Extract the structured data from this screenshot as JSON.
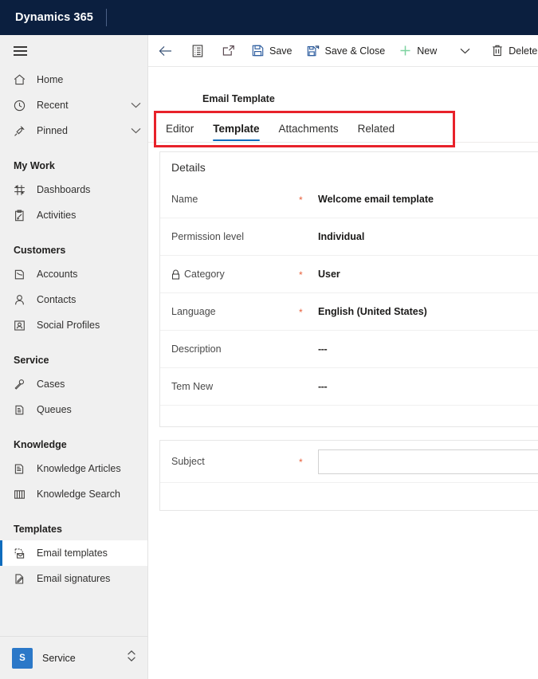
{
  "brand": {
    "title": "Dynamics 365"
  },
  "commandbar": {
    "back": {
      "name": "back",
      "label": ""
    },
    "form_selector": {
      "name": "form-selector",
      "label": ""
    },
    "popout": {
      "name": "popout",
      "label": ""
    },
    "save": {
      "label": "Save"
    },
    "save_and_close": {
      "label": "Save & Close"
    },
    "new": {
      "label": "New"
    },
    "overflow": {
      "label": ""
    },
    "delete": {
      "label": "Delete"
    }
  },
  "sidebar": {
    "hamburger_label": "",
    "items": [
      {
        "label": "Home",
        "icon": "home-icon",
        "type": "item",
        "selected": false,
        "chevron": false
      },
      {
        "label": "Recent",
        "icon": "clock-icon",
        "type": "item",
        "selected": false,
        "chevron": true
      },
      {
        "label": "Pinned",
        "icon": "pin-icon",
        "type": "item",
        "selected": false,
        "chevron": true
      }
    ],
    "groups": [
      {
        "title": "My Work",
        "items": [
          {
            "label": "Dashboards",
            "icon": "dashboard-icon",
            "selected": false
          },
          {
            "label": "Activities",
            "icon": "activities-icon",
            "selected": false
          }
        ]
      },
      {
        "title": "Customers",
        "items": [
          {
            "label": "Accounts",
            "icon": "account-icon",
            "selected": false
          },
          {
            "label": "Contacts",
            "icon": "contact-icon",
            "selected": false
          },
          {
            "label": "Social Profiles",
            "icon": "social-profile-icon",
            "selected": false
          }
        ]
      },
      {
        "title": "Service",
        "items": [
          {
            "label": "Cases",
            "icon": "case-icon",
            "selected": false
          },
          {
            "label": "Queues",
            "icon": "queue-icon",
            "selected": false
          }
        ]
      },
      {
        "title": "Knowledge",
        "items": [
          {
            "label": "Knowledge Articles",
            "icon": "knowledge-article-icon",
            "selected": false
          },
          {
            "label": "Knowledge Search",
            "icon": "knowledge-search-icon",
            "selected": false
          }
        ]
      },
      {
        "title": "Templates",
        "items": [
          {
            "label": "Email templates",
            "icon": "email-template-icon",
            "selected": true
          },
          {
            "label": "Email signatures",
            "icon": "email-signature-icon",
            "selected": false
          }
        ]
      }
    ],
    "area_switcher": {
      "badge": "S",
      "label": "Service"
    }
  },
  "record": {
    "entity_label": "Email Template"
  },
  "tabs": [
    {
      "label": "Editor",
      "active": false
    },
    {
      "label": "Template",
      "active": true
    },
    {
      "label": "Attachments",
      "active": false
    },
    {
      "label": "Related",
      "active": false
    }
  ],
  "details_section": {
    "heading": "Details",
    "fields": [
      {
        "label": "Name",
        "required": true,
        "locked": false,
        "value": "Welcome email template",
        "type": "text"
      },
      {
        "label": "Permission level",
        "required": false,
        "locked": false,
        "value": "Individual",
        "type": "text"
      },
      {
        "label": "Category",
        "required": true,
        "locked": true,
        "value": "User",
        "type": "text"
      },
      {
        "label": "Language",
        "required": true,
        "locked": false,
        "value": "English (United States)",
        "type": "text"
      },
      {
        "label": "Description",
        "required": false,
        "locked": false,
        "value": "---",
        "type": "text"
      },
      {
        "label": "Tem New",
        "required": false,
        "locked": false,
        "value": "---",
        "type": "text"
      }
    ]
  },
  "subject_section": {
    "field": {
      "label": "Subject",
      "required": true,
      "value": "",
      "placeholder": ""
    }
  },
  "annotation": {
    "type": "highlight-rectangle",
    "color": "#e8222a",
    "target": "tab-strip"
  },
  "colors": {
    "brand_bar": "#0b1f3f",
    "accent": "#0f6cbd",
    "required_star": "#e8603c",
    "annotation_red": "#e8222a",
    "sidebar_bg": "#f0f0f0",
    "area_badge": "#2b78c8",
    "new_plus_green": "#7dd3a0"
  }
}
